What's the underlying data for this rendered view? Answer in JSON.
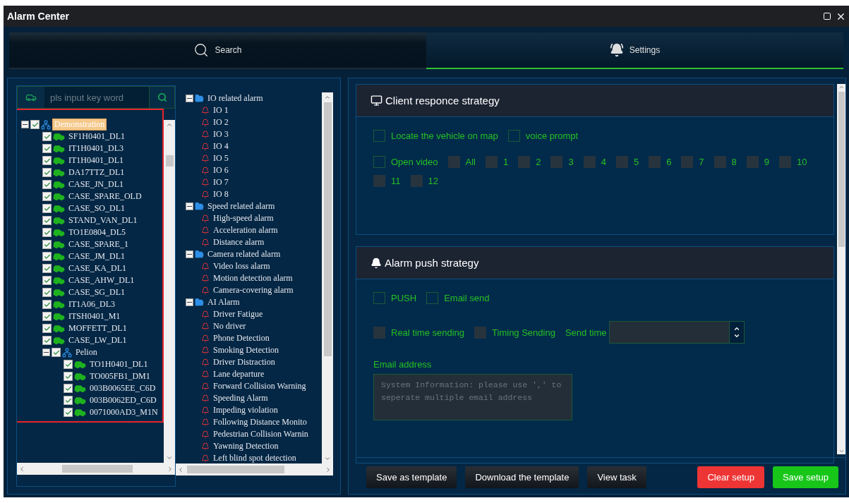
{
  "window": {
    "title": "Alarm Center"
  },
  "tabs": [
    {
      "label": "Search",
      "kind": "search",
      "selected": false
    },
    {
      "label": "Settings",
      "kind": "alarm",
      "selected": true
    }
  ],
  "vehicle_search": {
    "placeholder": "pls input key word"
  },
  "vehicle_tree": {
    "highlighted": true,
    "nodes": [
      {
        "kind": "group",
        "label": "Demonstration",
        "checked": true,
        "expanded": true,
        "selected": true,
        "children": [
          {
            "kind": "vehicle",
            "label": "SF1H0401_DL1",
            "checked": true,
            "selected": false
          },
          {
            "kind": "vehicle",
            "label": "IT1H0401_DL3",
            "checked": true,
            "selected": false
          },
          {
            "kind": "vehicle",
            "label": "IT1H0401_DL1",
            "checked": true,
            "selected": false
          },
          {
            "kind": "vehicle",
            "label": "DA17TTZ_DL1",
            "checked": true,
            "selected": false
          },
          {
            "kind": "vehicle",
            "label": "CASE_JN_DL1",
            "checked": true,
            "selected": false
          },
          {
            "kind": "vehicle",
            "label": "CASE_SPARE_OLD",
            "checked": true,
            "selected": false
          },
          {
            "kind": "vehicle",
            "label": "CASE_SO_DL1",
            "checked": true,
            "selected": false
          },
          {
            "kind": "vehicle",
            "label": "STAND_VAN_DL1",
            "checked": true,
            "selected": false
          },
          {
            "kind": "vehicle",
            "label": "TO1E0804_DL5",
            "checked": true,
            "selected": false
          },
          {
            "kind": "vehicle",
            "label": "CASE_SPARE_1",
            "checked": true,
            "selected": false
          },
          {
            "kind": "vehicle",
            "label": "CASE_JM_DL1",
            "checked": true,
            "selected": false
          },
          {
            "kind": "vehicle",
            "label": "CASE_KA_DL1",
            "checked": true,
            "selected": false
          },
          {
            "kind": "vehicle",
            "label": "CASE_AHW_DL1",
            "checked": true,
            "selected": false
          },
          {
            "kind": "vehicle",
            "label": "CASE_SG_DL1",
            "checked": true,
            "selected": false
          },
          {
            "kind": "vehicle",
            "label": "IT1A06_DL3",
            "checked": true,
            "selected": false
          },
          {
            "kind": "vehicle",
            "label": "ITSH0401_M1",
            "checked": true,
            "selected": false
          },
          {
            "kind": "vehicle",
            "label": "MOFFETT_DL1",
            "checked": true,
            "selected": false
          },
          {
            "kind": "vehicle",
            "label": "CASE_LW_DL1",
            "checked": true,
            "selected": false
          },
          {
            "kind": "group",
            "label": "Pelion",
            "checked": true,
            "expanded": true,
            "selected": false,
            "children": [
              {
                "kind": "vehicle",
                "label": "TO1H0401_DL1",
                "checked": true,
                "selected": false
              },
              {
                "kind": "vehicle",
                "label": "TO005FB1_DM1",
                "checked": true,
                "selected": false
              },
              {
                "kind": "vehicle",
                "label": "003B0065EE_C6D",
                "checked": true,
                "selected": false
              },
              {
                "kind": "vehicle",
                "label": "003B0062ED_C6D",
                "checked": true,
                "selected": false
              },
              {
                "kind": "vehicle",
                "label": "0071000AD3_M1N",
                "checked": true,
                "selected": false
              }
            ]
          }
        ]
      }
    ]
  },
  "alarm_tree": [
    {
      "label": "IO related alarm",
      "expanded": true,
      "children": [
        {
          "label": "IO 1"
        },
        {
          "label": "IO 2"
        },
        {
          "label": "IO 3"
        },
        {
          "label": "IO 4"
        },
        {
          "label": "IO 5"
        },
        {
          "label": "IO 6"
        },
        {
          "label": "IO 7"
        },
        {
          "label": "IO 8"
        }
      ]
    },
    {
      "label": "Speed related alarm",
      "expanded": true,
      "children": [
        {
          "label": "High-speed alarm"
        },
        {
          "label": "Acceleration alarm"
        },
        {
          "label": "Distance alarm"
        }
      ]
    },
    {
      "label": "Camera related alarm",
      "expanded": true,
      "children": [
        {
          "label": "Video loss alarm"
        },
        {
          "label": "Motion detection alarm"
        },
        {
          "label": "Camera-covering alarm"
        }
      ]
    },
    {
      "label": "AI Alarm",
      "expanded": true,
      "children": [
        {
          "label": "Driver Fatigue"
        },
        {
          "label": "No driver"
        },
        {
          "label": "Phone Detection"
        },
        {
          "label": "Smoking Detection"
        },
        {
          "label": "Driver Distraction"
        },
        {
          "label": "Lane departure"
        },
        {
          "label": "Forward Collision Warning"
        },
        {
          "label": "Speeding Alarm"
        },
        {
          "label": "Impeding violation"
        },
        {
          "label": "Following Distance Monito"
        },
        {
          "label": "Pedestrian Collision Warnin"
        },
        {
          "label": "Yawning Detection"
        },
        {
          "label": "Left blind spot detection"
        }
      ]
    }
  ],
  "client_strategy": {
    "title": "Client responce strategy",
    "lines": [
      {
        "options": [
          {
            "label": "Locate the vehicle on map",
            "checked": false,
            "disabled": false
          },
          {
            "label": "voice prompt",
            "checked": false,
            "disabled": false
          }
        ]
      },
      {
        "options": [
          {
            "label": "Open video",
            "checked": false,
            "disabled": false
          },
          {
            "label": "All",
            "checked": false,
            "disabled": true
          },
          {
            "label": "1",
            "checked": false,
            "disabled": true
          },
          {
            "label": "2",
            "checked": false,
            "disabled": true
          },
          {
            "label": "3",
            "checked": false,
            "disabled": true
          },
          {
            "label": "4",
            "checked": false,
            "disabled": true
          },
          {
            "label": "5",
            "checked": false,
            "disabled": true
          },
          {
            "label": "6",
            "checked": false,
            "disabled": true
          },
          {
            "label": "7",
            "checked": false,
            "disabled": true
          },
          {
            "label": "8",
            "checked": false,
            "disabled": true
          },
          {
            "label": "9",
            "checked": false,
            "disabled": true
          },
          {
            "label": "10",
            "checked": false,
            "disabled": true
          }
        ]
      },
      {
        "options": [
          {
            "label": "11",
            "checked": false,
            "disabled": true
          },
          {
            "label": "12",
            "checked": false,
            "disabled": true
          }
        ]
      }
    ]
  },
  "push_strategy": {
    "title": "Alarm push strategy",
    "options": [
      {
        "label": "PUSH",
        "checked": false,
        "disabled": false
      },
      {
        "label": "Email send",
        "checked": false,
        "disabled": false
      }
    ],
    "send_modes": [
      {
        "label": "Real time sending",
        "checked": false,
        "disabled": true
      },
      {
        "label": "Timing Sending",
        "checked": false,
        "disabled": true
      }
    ],
    "send_time": {
      "label": "Send time"
    },
    "email": {
      "label": "Email address",
      "placeholder": "System Information: please use ',' to seperate multiple email address"
    }
  },
  "buttons": [
    {
      "label": "Save as template",
      "kind": "default"
    },
    {
      "label": "Download the template",
      "kind": "default"
    },
    {
      "label": "View task",
      "kind": "default"
    },
    {
      "label": "Clear setup",
      "kind": "danger"
    },
    {
      "label": "Save setup",
      "kind": "primary"
    }
  ]
}
